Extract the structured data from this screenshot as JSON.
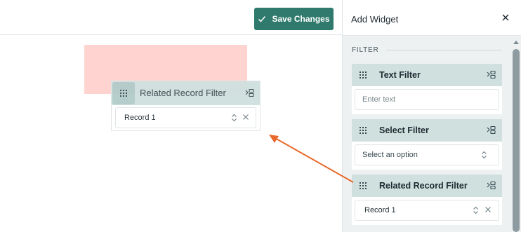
{
  "toolbar": {
    "save_label": "Save Changes"
  },
  "drag_widget": {
    "title": "Related Record Filter",
    "value": "Record 1"
  },
  "panel": {
    "title": "Add Widget",
    "section_label": "FILTER",
    "cards": [
      {
        "title": "Text Filter",
        "placeholder": "Enter text"
      },
      {
        "title": "Select Filter",
        "placeholder": "Select an option"
      },
      {
        "title": "Related Record Filter",
        "value": "Record 1"
      }
    ]
  },
  "colors": {
    "primary_button": "#2f7a6c",
    "card_header": "#cfe0df",
    "drop_zone": "#ffd4d0",
    "arrow": "#e8692b"
  }
}
